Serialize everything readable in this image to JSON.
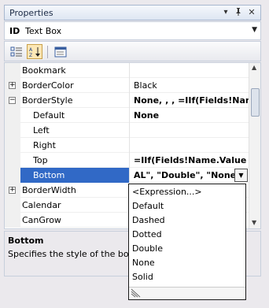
{
  "window": {
    "title": "Properties"
  },
  "title_buttons": {
    "dropdown": "▾",
    "pin": "📌",
    "close": "✕"
  },
  "object_selector": {
    "id_label": "ID",
    "value": "Text Box"
  },
  "toolbar": {
    "active_tool": "alphabetical"
  },
  "grid": {
    "rows": [
      {
        "label": "Bookmark",
        "value": "",
        "expander": ""
      },
      {
        "label": "BorderColor",
        "value": "Black",
        "expander": "+"
      },
      {
        "label": "BorderStyle",
        "value": "None, , , =IIf(Fields!Name.",
        "expander": "−",
        "bold": true
      },
      {
        "label": "Default",
        "value": "None",
        "sub": true,
        "bold": true
      },
      {
        "label": "Left",
        "value": "",
        "sub": true
      },
      {
        "label": "Right",
        "value": "",
        "sub": true
      },
      {
        "label": "Top",
        "value": "=IIf(Fields!Name.Value = \"",
        "sub": true,
        "bold": true
      },
      {
        "label": "Bottom",
        "value": "AL\", \"Double\", \"None\")",
        "sub": true,
        "bold": true,
        "selected": true
      },
      {
        "label": "BorderWidth",
        "value": "",
        "expander": "+"
      },
      {
        "label": "Calendar",
        "value": ""
      },
      {
        "label": "CanGrow",
        "value": ""
      }
    ]
  },
  "description": {
    "title": "Bottom",
    "text": "Specifies the style of the bott"
  },
  "dropdown": {
    "options": [
      "<Expression...>",
      "Default",
      "Dashed",
      "Dotted",
      "Double",
      "None",
      "Solid"
    ]
  },
  "colors": {
    "selection": "#3169c6",
    "accent": "#c9a04a"
  }
}
